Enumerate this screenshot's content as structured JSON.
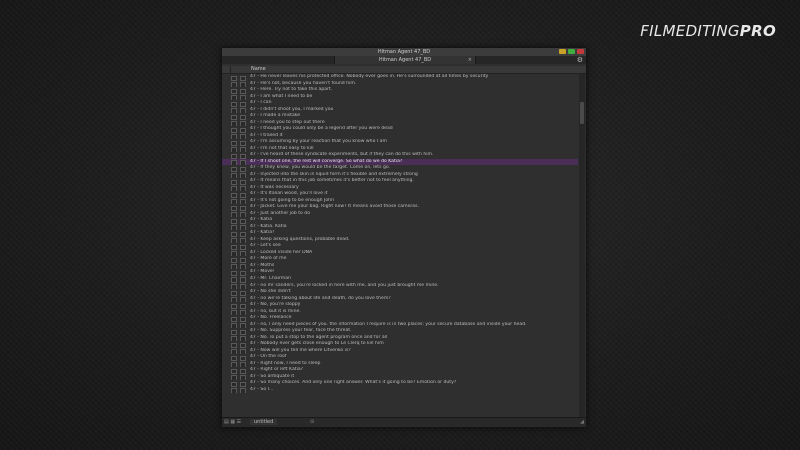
{
  "logo": {
    "part1": "FILMEDITING",
    "part2": "PRO"
  },
  "window": {
    "title": "Hitman Agent 47_BD",
    "tab_label": "Hitman Agent 47_BD",
    "tab_close": "×",
    "controls_colors": {
      "minimize": "#c9a227",
      "maximize": "#3fae3f",
      "close": "#c43a3a"
    }
  },
  "columns": {
    "name": "Name"
  },
  "selected_index": 13,
  "rows": [
    "47 - He never leaves his protected office. Nobody ever goes in. He's surrounded at all times by security",
    "47 - He's not, because you haven't found him.",
    "47 - Here. Try not to fake this apart.",
    "47 - I am what I need to be",
    "47 - I can",
    "47 - I didn't shoot you, I marked you",
    "47 - I made a mistake",
    "47 - I need you to step out there",
    "47 - I thought you could only be a legend after you were dead",
    "47 - I trailed it",
    "47 - I'm assuming by your reaction that you know who I am",
    "47 - I'm not that easy to kill",
    "47 - I've heard of these syndicate experiments, but if they can do this with him.",
    "47 - If I shoot one, the rest will converge. So what do we do Katia?",
    "47 - If they knew, you would be the target. Come on, lets go.",
    "47 - Injected into the skin in liquid form it's flexible and extremely strong",
    "47 - It means that in this job sometimes it's better not to feel anything.",
    "47 - It was necessary",
    "47 - It's Italian wood, you'll love it",
    "47 - It's not going to be enough John",
    "47 - Jacket. Give me your bag. Right now? It means avoid those cameras.",
    "47 - Just another job to do",
    "47 - Katia",
    "47 - Katia. Katia",
    "47 - Katia?",
    "47 - Keep asking questions, probable dead.",
    "47 - Let's see",
    "47 - Locked inside her DNA",
    "47 - More of me",
    "47 - Moths",
    "47 - Move!",
    "47 - Mr. Chairman",
    "47 - no mr sanders, you're locked in here with me, and you just brought me mine.",
    "47 - No she didn't",
    "47 - no we're talking about life and death, do you love them?",
    "47 - No, you're sloppy",
    "47 - no, but it is mine.",
    "47 - No. Freelance",
    "47 - no, I only need pieces of you. the information I require is in two places: your secure database and inside your head.",
    "47 - No. Suppress your fear, face the threat.",
    "47 - No. To put a stop to the agent program once and for all",
    "47 - Nobody ever gets close enough to Le Clerq to kill him",
    "47 - Now will you tell me where Litvenko is?",
    "47 - On the roof",
    "47 - Right now, I need to sleep",
    "47 - Right or left Katia?",
    "47 - So antiquate it",
    "47 - So many choices. And only one right answer. What's it going to be? Emotion or duty?",
    "47 - So I..."
  ],
  "footer": {
    "label": "untitled",
    "zoom_icon": "zoom-icon"
  }
}
